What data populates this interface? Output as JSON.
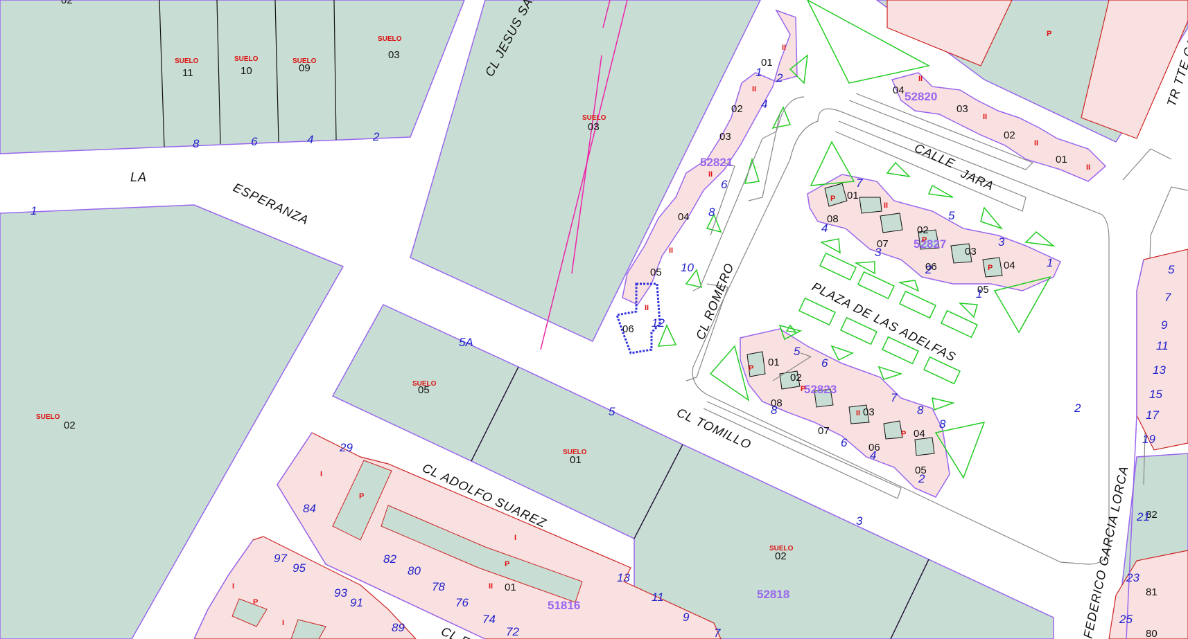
{
  "streets": {
    "la": "LA",
    "esperanza": "ESPERANZA",
    "jesus_sanchez": "CL JESUS SANCHE",
    "calle": "CALLE",
    "jara": "JARA",
    "tr_tte": "TR TTE CA",
    "romero": "CL ROMERO",
    "plaza_adelfas": "PLAZA DE LAS ADELFAS",
    "tomillo": "CL TOMILLO",
    "adolfo_suarez": "CL ADOLFO SUAREZ",
    "garcia_lorca": "FEDERICO GARCIA LORCA",
    "cl_bottom": "CL EG"
  },
  "blocks": {
    "b52821": "52821",
    "b52820": "52820",
    "b52827": "52827",
    "b52823": "52823",
    "b51816": "51816",
    "b52818": "52818"
  },
  "suelo": "SUELO",
  "markers": {
    "ii": "II",
    "p": "P",
    "i": "I"
  },
  "parcels": {
    "p_02_top": "02",
    "p_11": "11",
    "p_10": "10",
    "p_09": "09",
    "p_03_a": "03",
    "p_03_b": "03",
    "p_02_left": "02",
    "p_05_mid": "05",
    "p_01_mid": "01",
    "p_02_bot": "02",
    "p_01_bot": "01",
    "r_01": "01",
    "r_02": "02",
    "r_03": "03",
    "r_04": "04",
    "r_05": "05",
    "r_06": "06",
    "j_04": "04",
    "j_03": "03",
    "j_02": "02",
    "j_01": "01",
    "a_01": "01",
    "a_08": "08",
    "a_02": "02",
    "a_07": "07",
    "a_06": "06",
    "a_03": "03",
    "a_05": "05",
    "a_04": "04",
    "c_01": "01",
    "c_02": "02",
    "c_08": "08",
    "c_07": "07",
    "c_03": "03",
    "c_06": "06",
    "c_04": "04",
    "c_05": "05",
    "e_82": "82",
    "e_81": "81",
    "e_80": "80"
  },
  "house_numbers": {
    "n8": "8",
    "n6": "6",
    "n4": "4",
    "n2": "2",
    "n1": "1",
    "r1": "1",
    "r2": "2",
    "r4": "4",
    "r6": "6",
    "r8": "8",
    "r10": "10",
    "r12": "12",
    "n5a": "5A",
    "n5": "5",
    "n3": "3",
    "n29": "29",
    "n84": "84",
    "n97": "97",
    "n95": "95",
    "n93": "93",
    "n91": "91",
    "n89": "89",
    "n82": "82",
    "n80": "80",
    "n78": "78",
    "n76": "76",
    "n74": "74",
    "n72": "72",
    "n13": "13",
    "n11": "11",
    "n9": "9",
    "n7": "7",
    "a7": "7",
    "a5": "5",
    "a4": "4",
    "a3a": "3",
    "a3b": "3",
    "a2": "2",
    "a1a": "1",
    "a1b": "1",
    "c5": "5",
    "c6": "6",
    "c7": "7",
    "c8a": "8",
    "c8b": "8",
    "c8c": "8",
    "c6b": "6",
    "c4": "4",
    "c2": "2",
    "g2": "2",
    "e5": "5",
    "e7": "7",
    "e9": "9",
    "e11": "11",
    "e13": "13",
    "e15": "15",
    "e17": "17",
    "e19": "19",
    "e21": "21",
    "e23": "23",
    "e25": "25"
  },
  "colors": {
    "background": "#ffffff",
    "lot_fill": "#c8ddd3",
    "building_fill": "#f9e1e1",
    "block_border": "#9966ee",
    "house_number": "#2222cc",
    "suelo_label": "#dd1111",
    "plaza_outline": "#22cc22",
    "survey_line": "#ee22aa"
  }
}
